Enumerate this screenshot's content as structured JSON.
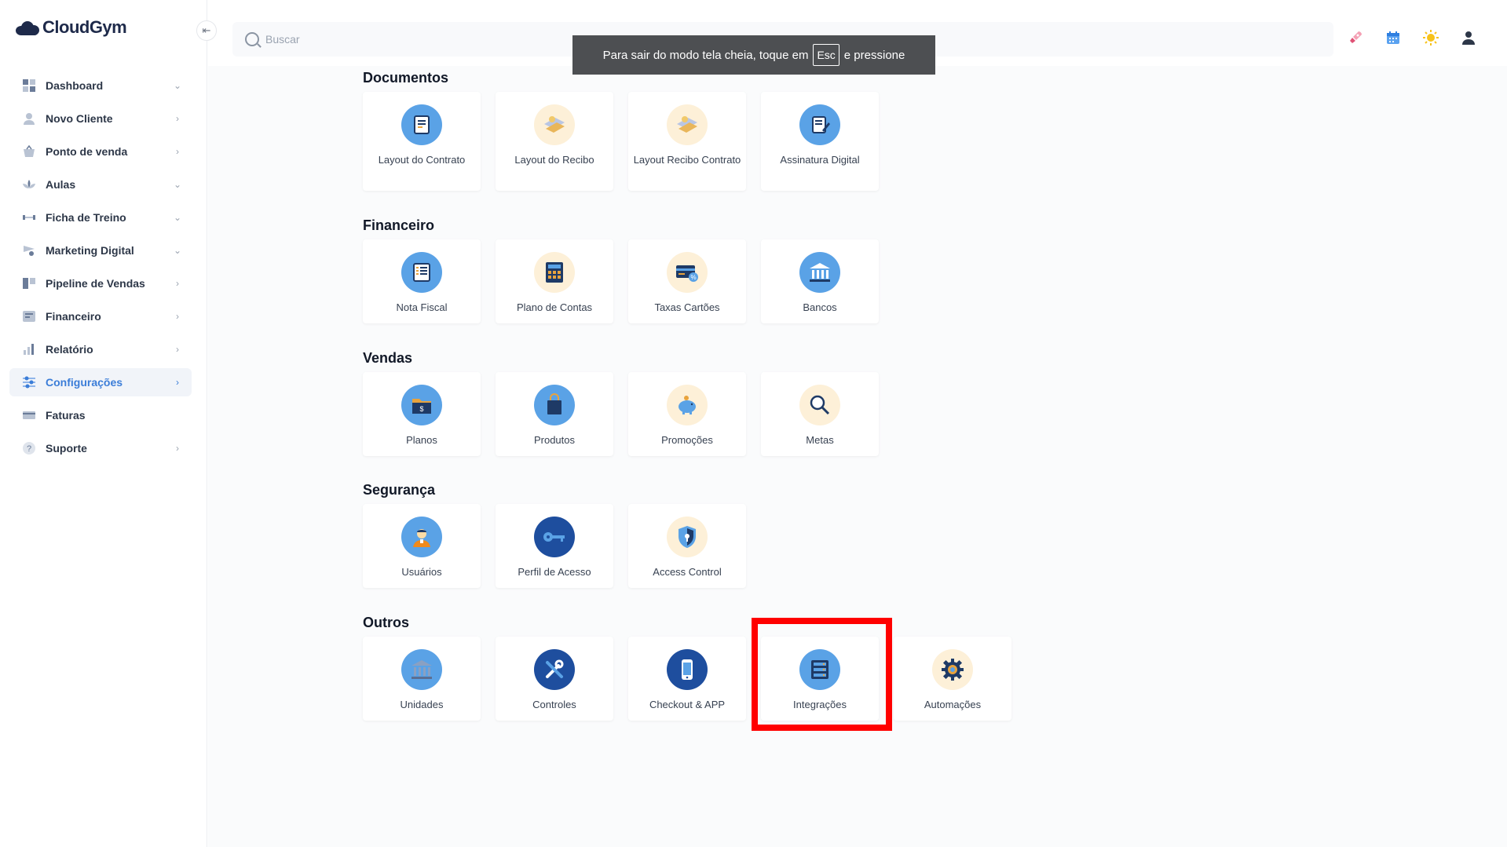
{
  "app": {
    "name": "CloudGym"
  },
  "sidebar": {
    "items": [
      {
        "label": "Dashboard",
        "chevron": "⌄",
        "icon": "dashboard-icon"
      },
      {
        "label": "Novo Cliente",
        "chevron": "›",
        "icon": "user-icon"
      },
      {
        "label": "Ponto de venda",
        "chevron": "›",
        "icon": "basket-icon"
      },
      {
        "label": "Aulas",
        "chevron": "⌄",
        "icon": "lotus-icon"
      },
      {
        "label": "Ficha de Treino",
        "chevron": "⌄",
        "icon": "dumbbell-icon"
      },
      {
        "label": "Marketing Digital",
        "chevron": "⌄",
        "icon": "marketing-icon"
      },
      {
        "label": "Pipeline de Vendas",
        "chevron": "›",
        "icon": "pipeline-icon"
      },
      {
        "label": "Financeiro",
        "chevron": "›",
        "icon": "finance-icon"
      },
      {
        "label": "Relatório",
        "chevron": "›",
        "icon": "report-icon"
      },
      {
        "label": "Configurações",
        "chevron": "›",
        "icon": "settings-sliders-icon",
        "active": true
      },
      {
        "label": "Faturas",
        "chevron": "",
        "icon": "card-icon"
      },
      {
        "label": "Suporte",
        "chevron": "›",
        "icon": "help-icon"
      }
    ]
  },
  "search": {
    "placeholder": "Buscar"
  },
  "toast": {
    "before": "Para sair do modo tela cheia, toque em",
    "key": "Esc",
    "after": "e pressione"
  },
  "sections": [
    {
      "title": "Documentos",
      "cards": [
        {
          "label": "Layout do Contrato",
          "icon": "contract-icon"
        },
        {
          "label": "Layout do Recibo",
          "icon": "receipt-icon"
        },
        {
          "label": "Layout Recibo Contrato",
          "icon": "receipt-contract-icon"
        },
        {
          "label": "Assinatura Digital",
          "icon": "digital-signature-icon"
        }
      ]
    },
    {
      "title": "Financeiro",
      "cards": [
        {
          "label": "Nota Fiscal",
          "icon": "invoice-icon"
        },
        {
          "label": "Plano de Contas",
          "icon": "calculator-icon"
        },
        {
          "label": "Taxas Cartões",
          "icon": "credit-card-icon"
        },
        {
          "label": "Bancos",
          "icon": "bank-icon"
        }
      ]
    },
    {
      "title": "Vendas",
      "cards": [
        {
          "label": "Planos",
          "icon": "plans-folder-icon"
        },
        {
          "label": "Produtos",
          "icon": "shopping-bag-icon"
        },
        {
          "label": "Promoções",
          "icon": "piggy-bank-icon"
        },
        {
          "label": "Metas",
          "icon": "magnifier-icon"
        }
      ]
    },
    {
      "title": "Segurança",
      "cards": [
        {
          "label": "Usuários",
          "icon": "user-avatar-icon"
        },
        {
          "label": "Perfil de Acesso",
          "icon": "key-icon"
        },
        {
          "label": "Access Control",
          "icon": "shield-lock-icon"
        }
      ]
    },
    {
      "title": "Outros",
      "cards": [
        {
          "label": "Unidades",
          "icon": "building-icon"
        },
        {
          "label": "Controles",
          "icon": "tools-icon"
        },
        {
          "label": "Checkout & APP",
          "icon": "smartphone-icon"
        },
        {
          "label": "Integrações",
          "icon": "server-rack-icon"
        },
        {
          "label": "Automações",
          "icon": "gear-automation-icon"
        }
      ]
    }
  ],
  "colors": {
    "accent": "#3b7dd8",
    "highlight": "#ff0000",
    "sidebar_text": "#2d3748"
  }
}
